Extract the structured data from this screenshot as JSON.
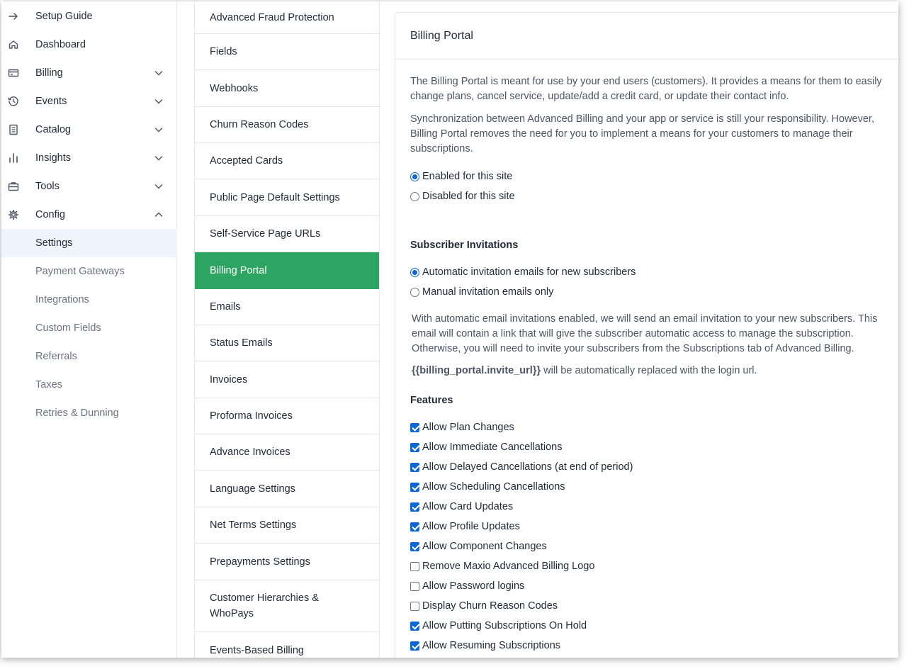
{
  "nav": {
    "items": [
      {
        "label": "Setup Guide",
        "icon": "arrow-right-icon",
        "chevron": ""
      },
      {
        "label": "Dashboard",
        "icon": "home-icon",
        "chevron": ""
      },
      {
        "label": "Billing",
        "icon": "credit-card-icon",
        "chevron": "down"
      },
      {
        "label": "Events",
        "icon": "history-icon",
        "chevron": "down"
      },
      {
        "label": "Catalog",
        "icon": "catalog-icon",
        "chevron": "down"
      },
      {
        "label": "Insights",
        "icon": "bar-chart-icon",
        "chevron": "down"
      },
      {
        "label": "Tools",
        "icon": "briefcase-icon",
        "chevron": "down"
      },
      {
        "label": "Config",
        "icon": "gear-icon",
        "chevron": "up"
      }
    ],
    "config_sub": [
      {
        "label": "Settings",
        "active": true
      },
      {
        "label": "Payment Gateways",
        "active": false
      },
      {
        "label": "Integrations",
        "active": false
      },
      {
        "label": "Custom Fields",
        "active": false
      },
      {
        "label": "Referrals",
        "active": false
      },
      {
        "label": "Taxes",
        "active": false
      },
      {
        "label": "Retries & Dunning",
        "active": false
      }
    ]
  },
  "settings": {
    "items": [
      {
        "label": "Advanced Fraud Protection"
      },
      {
        "label": "Fields"
      },
      {
        "label": "Webhooks"
      },
      {
        "label": "Churn Reason Codes"
      },
      {
        "label": "Accepted Cards"
      },
      {
        "label": "Public Page Default Settings"
      },
      {
        "label": "Self-Service Page URLs"
      },
      {
        "label": "Billing Portal",
        "active": true
      },
      {
        "label": "Emails"
      },
      {
        "label": "Status Emails"
      },
      {
        "label": "Invoices"
      },
      {
        "label": "Proforma Invoices"
      },
      {
        "label": "Advance Invoices"
      },
      {
        "label": "Language Settings"
      },
      {
        "label": "Net Terms Settings"
      },
      {
        "label": "Prepayments Settings"
      },
      {
        "label": "Customer Hierarchies & WhoPays"
      },
      {
        "label": "Events-Based Billing"
      }
    ]
  },
  "panel": {
    "title": "Billing Portal",
    "intro1": "The Billing Portal is meant for use by your end users (customers). It provides a means for them to easily change plans, cancel service, update/add a credit card, or update their contact info.",
    "intro2": "Synchronization between Advanced Billing and your app or service is still your responsibility. However, Billing Portal removes the need for you to implement a means for your customers to manage their subscriptions.",
    "site_options": [
      {
        "label": "Enabled for this site",
        "selected": true
      },
      {
        "label": "Disabled for this site",
        "selected": false
      }
    ],
    "invitations": {
      "title": "Subscriber Invitations",
      "options": [
        {
          "label": "Automatic invitation emails for new subscribers",
          "selected": true
        },
        {
          "label": "Manual invitation emails only",
          "selected": false
        }
      ],
      "note": "With automatic email invitations enabled, we will send an email invitation to your new subscribers. This email will contain a link that will give the subscriber automatic access to manage the subscription. Otherwise, you will need to invite your subscribers from the Subscriptions tab of Advanced Billing.",
      "token": "{{billing_portal.invite_url}}",
      "token_note": " will be automatically replaced with the login url."
    },
    "features": {
      "title": "Features",
      "items": [
        {
          "label": "Allow Plan Changes",
          "checked": true
        },
        {
          "label": "Allow Immediate Cancellations",
          "checked": true
        },
        {
          "label": "Allow Delayed Cancellations (at end of period)",
          "checked": true
        },
        {
          "label": "Allow Scheduling Cancellations",
          "checked": true
        },
        {
          "label": "Allow Card Updates",
          "checked": true
        },
        {
          "label": "Allow Profile Updates",
          "checked": true
        },
        {
          "label": "Allow Component Changes",
          "checked": true
        },
        {
          "label": "Remove Maxio Advanced Billing Logo",
          "checked": false
        },
        {
          "label": "Allow Password logins",
          "checked": false
        },
        {
          "label": "Display Churn Reason Codes",
          "checked": false
        },
        {
          "label": "Allow Putting Subscriptions On Hold",
          "checked": true
        },
        {
          "label": "Allow Resuming Subscriptions",
          "checked": true
        }
      ]
    }
  },
  "colors": {
    "accent_green": "#2da562",
    "check_blue": "#0b67d8",
    "active_nav_bg": "#eff5fd"
  }
}
